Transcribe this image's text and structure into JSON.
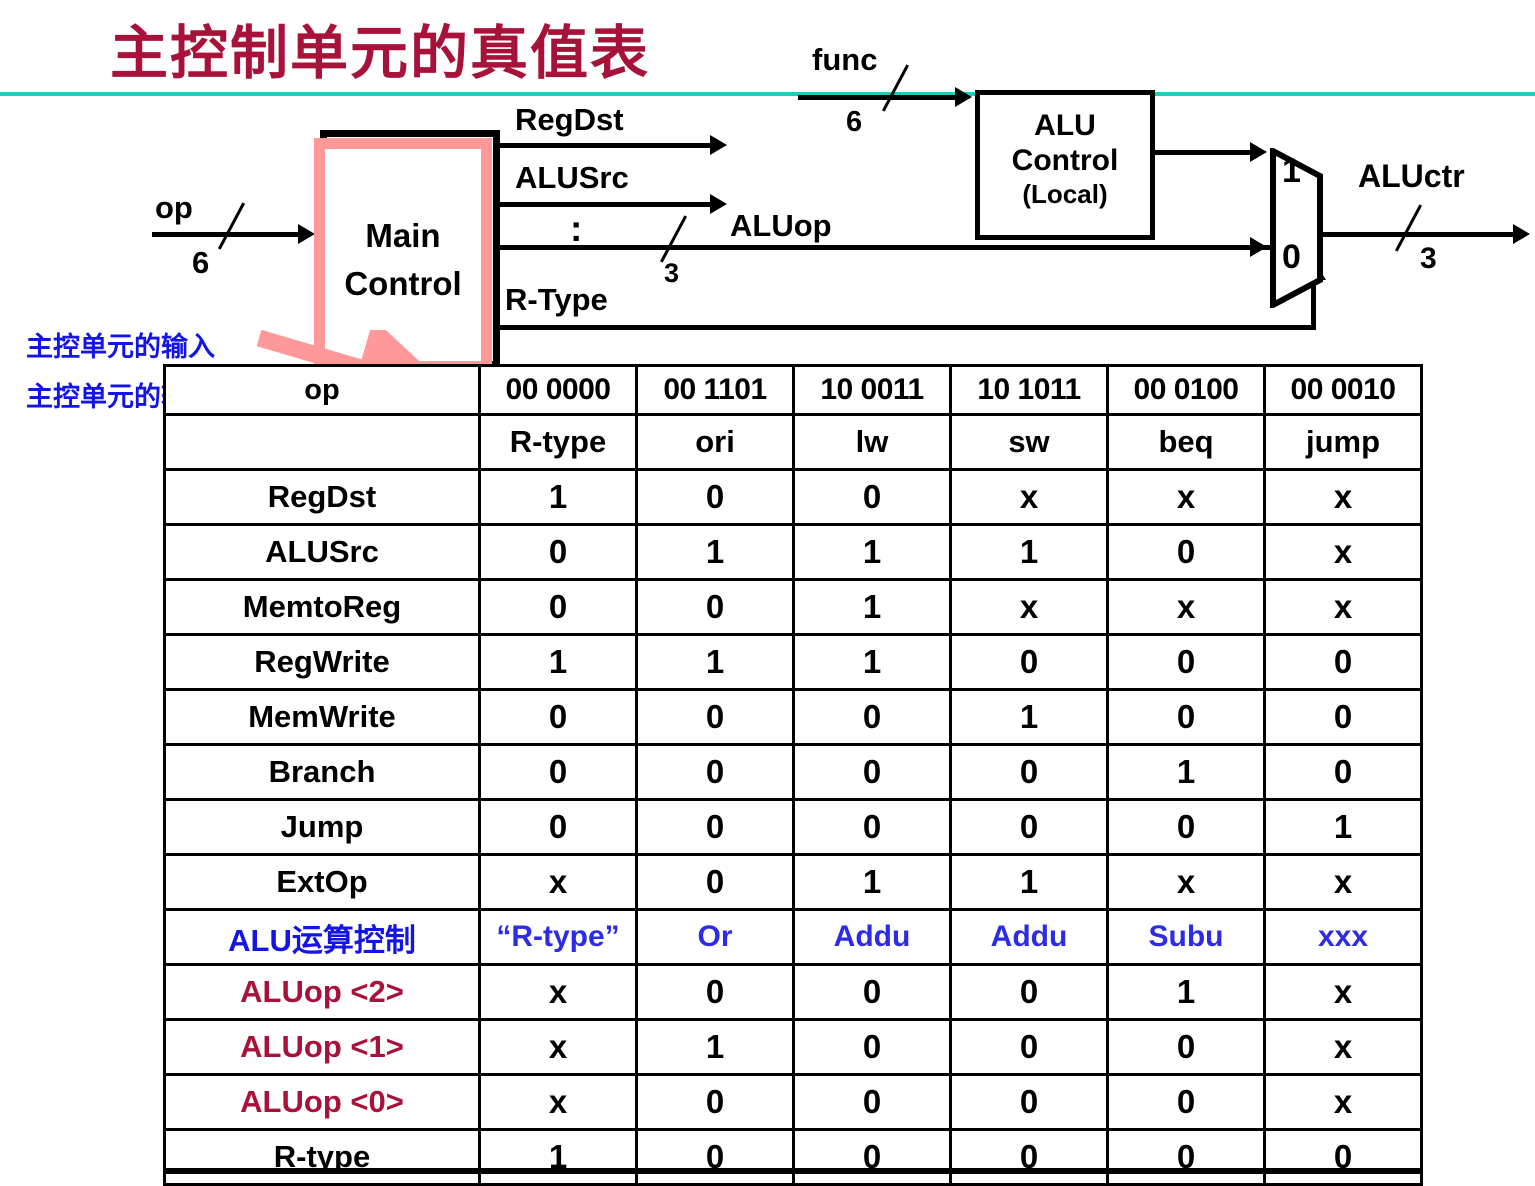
{
  "title": "主控制单元的真值表",
  "colors": {
    "title": "#A8123A",
    "rule": "#22CCBB",
    "annotation": "#1414E6",
    "highlight_bg": "#FBDFE4",
    "pink_box": "#FF9999",
    "crimson": "#A8123A",
    "blue_value": "#2B2BE8"
  },
  "diagram": {
    "input_signal": {
      "label": "op",
      "width": "6"
    },
    "main_control": {
      "line1": "Main",
      "line2": "Control"
    },
    "outputs": [
      {
        "label": "RegDst"
      },
      {
        "label": "ALUSrc"
      },
      {
        "label": ":"
      },
      {
        "label": "ALUop",
        "width": "3"
      },
      {
        "label": "R-Type"
      }
    ],
    "func_signal": {
      "label": "func",
      "width": "6"
    },
    "alu_control": {
      "line1": "ALU",
      "line2": "Control",
      "line3": "(Local)"
    },
    "mux": {
      "top_port": "1",
      "bottom_port": "0"
    },
    "output_signal": {
      "label": "ALUctr",
      "width": "3"
    }
  },
  "annotations": [
    {
      "text": "主控单元的输入"
    },
    {
      "text": "主控单元的输出"
    }
  ],
  "table": {
    "op_label": "op",
    "opcodes": [
      "00 0000",
      "00 1101",
      "10 0011",
      "10 1011",
      "00 0100",
      "00 0010"
    ],
    "instructions": [
      "R-type",
      "ori",
      "lw",
      "sw",
      "beq",
      "jump"
    ],
    "rows": [
      {
        "label": "RegDst",
        "style": "plain",
        "values": [
          "1",
          "0",
          "0",
          "x",
          "x",
          "x"
        ]
      },
      {
        "label": "ALUSrc",
        "style": "plain",
        "values": [
          "0",
          "1",
          "1",
          "1",
          "0",
          "x"
        ]
      },
      {
        "label": "MemtoReg",
        "style": "plain",
        "values": [
          "0",
          "0",
          "1",
          "x",
          "x",
          "x"
        ]
      },
      {
        "label": "RegWrite",
        "style": "plain",
        "values": [
          "1",
          "1",
          "1",
          "0",
          "0",
          "0"
        ]
      },
      {
        "label": "MemWrite",
        "style": "plain",
        "values": [
          "0",
          "0",
          "0",
          "1",
          "0",
          "0"
        ]
      },
      {
        "label": "Branch",
        "style": "plain",
        "values": [
          "0",
          "0",
          "0",
          "0",
          "1",
          "0"
        ]
      },
      {
        "label": "Jump",
        "style": "plain",
        "values": [
          "0",
          "0",
          "0",
          "0",
          "0",
          "1"
        ]
      },
      {
        "label": "ExtOp",
        "style": "plain",
        "values": [
          "x",
          "0",
          "1",
          "1",
          "x",
          "x"
        ]
      },
      {
        "label": "ALU运算控制",
        "style": "blue",
        "values": [
          "“R-type”",
          "Or",
          "Addu",
          "Addu",
          "Subu",
          "xxx"
        ]
      },
      {
        "label": "ALUop <2>",
        "style": "crimson",
        "values": [
          "x",
          "0",
          "0",
          "0",
          "1",
          "x"
        ]
      },
      {
        "label": "ALUop <1>",
        "style": "crimson",
        "values": [
          "x",
          "1",
          "0",
          "0",
          "0",
          "x"
        ]
      },
      {
        "label": "ALUop <0>",
        "style": "crimson",
        "values": [
          "x",
          "0",
          "0",
          "0",
          "0",
          "x"
        ]
      },
      {
        "label": "R-type",
        "style": "plain",
        "values": [
          "1",
          "0",
          "0",
          "0",
          "0",
          "0"
        ]
      }
    ]
  }
}
